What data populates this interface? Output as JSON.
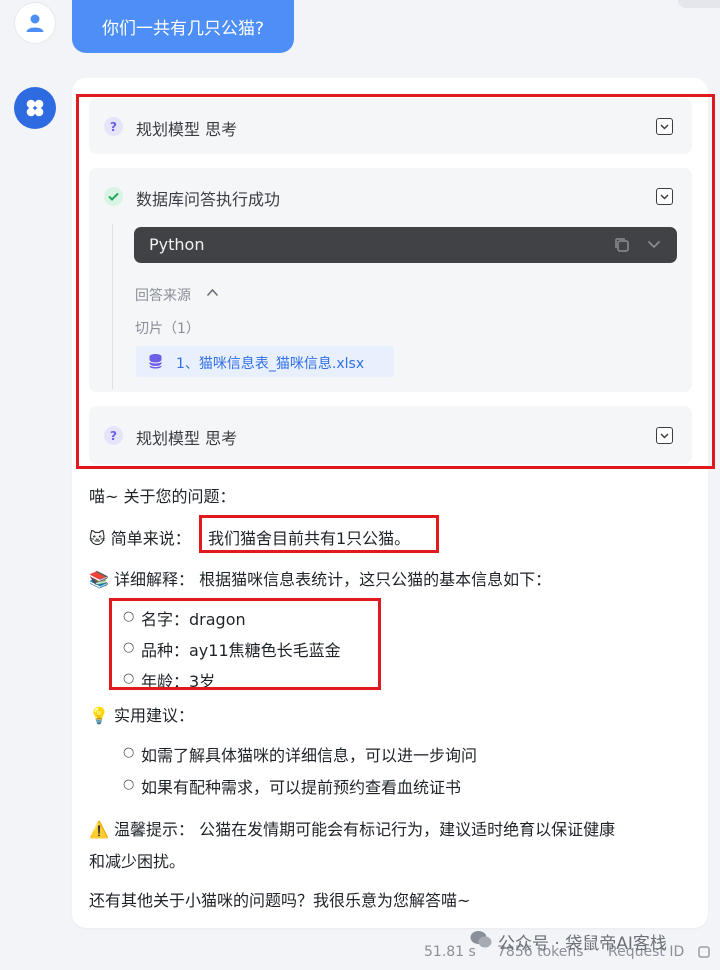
{
  "user": {
    "question": "你们一共有几只公猫?"
  },
  "steps": [
    {
      "title": "规划模型 思考",
      "status": "thinking"
    },
    {
      "title": "数据库问答执行成功",
      "status": "success",
      "code_language": "Python",
      "source_label": "回答来源",
      "slices_label": "切片（1）",
      "source_file": "1、猫咪信息表_猫咪信息.xlsx"
    },
    {
      "title": "规划模型 思考",
      "status": "thinking"
    }
  ],
  "answer": {
    "greeting": "喵~ 关于您的问题：",
    "summary_label": "简单来说：",
    "summary_text": "我们猫舍目前共有1只公猫。",
    "detail_label": "详细解释：",
    "detail_text": "根据猫咪信息表统计，这只公猫的基本信息如下：",
    "details": [
      "名字：dragon",
      "品种：ay11焦糖色长毛蓝金",
      "年龄：3岁"
    ],
    "advice_label": "实用建议：",
    "advice": [
      "如需了解具体猫咪的详细信息，可以进一步询问",
      "如果有配种需求，可以提前预约查看血统证书"
    ],
    "tip_label": "温馨提示：",
    "tip_line1": "公猫在发情期可能会有标记行为，建议适时绝育以保证健康",
    "tip_line2": "和减少困扰。",
    "closing": "还有其他关于小猫咪的问题吗？我很乐意为您解答喵~"
  },
  "footer": {
    "duration": "51.81 s",
    "tokens": "7856 tokens",
    "request_id": "Request ID"
  },
  "watermark": "公众号 · 袋鼠帝AI客栈",
  "icons": {
    "user_avatar": "user-icon",
    "bot_avatar": "clover-icon",
    "step_thinking": "question-icon",
    "step_success": "check-circle-icon",
    "expand": "expand-icon",
    "copy": "copy-icon",
    "chevron_down": "chevron-down-icon",
    "chevron_up": "chevron-up-icon",
    "database": "database-icon",
    "summary_emoji": "cat-icon",
    "detail_emoji": "books-icon",
    "advice_emoji": "lightbulb-icon",
    "tip_emoji": "warning-icon"
  },
  "colors": {
    "user_bubble": "#4d8ff7",
    "bot_icon": "#2f6be0",
    "highlight_red": "#e0191e",
    "link_blue": "#3370e6"
  }
}
